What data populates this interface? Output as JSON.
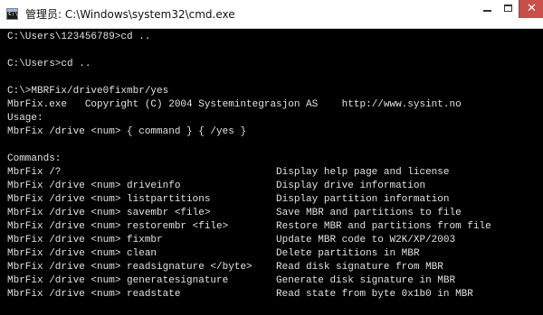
{
  "window": {
    "title": "管理员: C:\\Windows\\system32\\cmd.exe",
    "icon": "cmd-icon",
    "icon_glyph": "C:\\",
    "buttons": {
      "minimize": "minimize-icon",
      "maximize": "maximize-icon",
      "close": "close-icon",
      "close_glyph": "✕"
    }
  },
  "terminal": {
    "lines": [
      "C:\\Users\\123456789>cd ..",
      "",
      "C:\\Users>cd ..",
      "",
      "C:\\>MBRFix/drive0fixmbr/yes",
      "MbrFix.exe   Copyright (C) 2004 Systemintegrasjon AS    http://www.sysint.no",
      "Usage:",
      "MbrFix /drive <num> { command } { /yes }",
      "",
      "Commands:",
      "MbrFix /?                                    Display help page and license",
      "MbrFix /drive <num> driveinfo                Display drive information",
      "MbrFix /drive <num> listpartitions           Display partition information",
      "MbrFix /drive <num> savembr <file>           Save MBR and partitions to file",
      "MbrFix /drive <num> restorembr <file>        Restore MBR and partitions from file",
      "MbrFix /drive <num> fixmbr                   Update MBR code to W2K/XP/2003",
      "MbrFix /drive <num> clean                    Delete partitions in MBR",
      "MbrFix /drive <num> readsignature </byte>    Read disk signature from MBR",
      "MbrFix /drive <num> generatesignature        Generate disk signature in MBR",
      "MbrFix /drive <num> readstate                Read state from byte 0x1b0 in MBR"
    ]
  },
  "colors": {
    "background": "#000000",
    "text": "#e2e2e2",
    "titlebar": "#ffffff",
    "close_button": "#c7504b"
  }
}
